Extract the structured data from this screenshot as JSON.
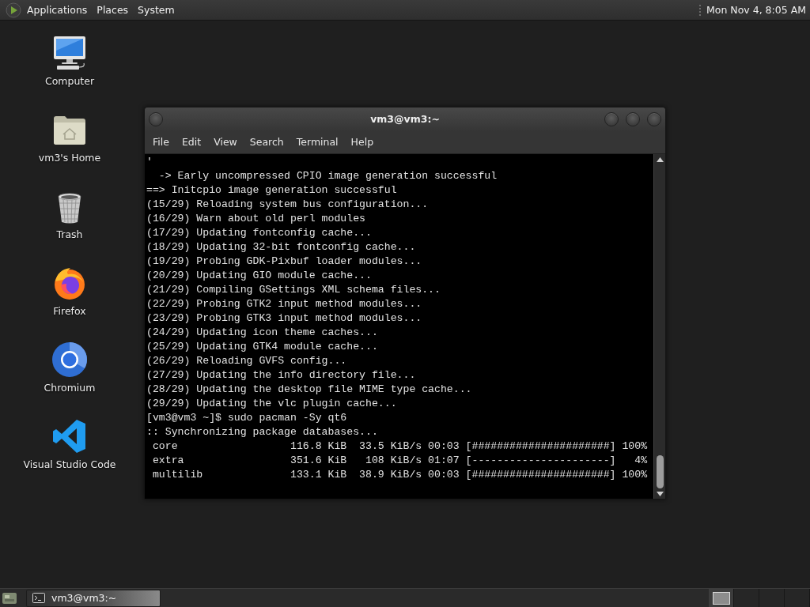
{
  "top_panel": {
    "menus": [
      "Applications",
      "Places",
      "System"
    ],
    "clock": "Mon Nov 4, 8:05 AM"
  },
  "desktop_icons": [
    {
      "label": "Computer",
      "kind": "computer"
    },
    {
      "label": "vm3's Home",
      "kind": "home"
    },
    {
      "label": "Trash",
      "kind": "trash"
    },
    {
      "label": "Firefox",
      "kind": "firefox"
    },
    {
      "label": "Chromium",
      "kind": "chromium"
    },
    {
      "label": "Visual Studio Code",
      "kind": "vscode"
    }
  ],
  "terminal_window": {
    "title": "vm3@vm3:~",
    "menu": [
      "File",
      "Edit",
      "View",
      "Search",
      "Terminal",
      "Help"
    ],
    "lines": [
      "'",
      "  -> Early uncompressed CPIO image generation successful",
      "==> Initcpio image generation successful",
      "(15/29) Reloading system bus configuration...",
      "(16/29) Warn about old perl modules",
      "(17/29) Updating fontconfig cache...",
      "(18/29) Updating 32-bit fontconfig cache...",
      "(19/29) Probing GDK-Pixbuf loader modules...",
      "(20/29) Updating GIO module cache...",
      "(21/29) Compiling GSettings XML schema files...",
      "(22/29) Probing GTK2 input method modules...",
      "(23/29) Probing GTK3 input method modules...",
      "(24/29) Updating icon theme caches...",
      "(25/29) Updating GTK4 module cache...",
      "(26/29) Reloading GVFS config...",
      "(27/29) Updating the info directory file...",
      "(28/29) Updating the desktop file MIME type cache...",
      "(29/29) Updating the vlc plugin cache...",
      "[vm3@vm3 ~]$ sudo pacman -Sy qt6",
      ":: Synchronizing package databases...",
      " core                  116.8 KiB  33.5 KiB/s 00:03 [######################] 100%",
      " extra                 351.6 KiB   108 KiB/s 01:07 [----------------------]   4%",
      " multilib              133.1 KiB  38.9 KiB/s 00:03 [######################] 100%"
    ]
  },
  "taskbar": {
    "tasks": [
      {
        "label": "vm3@vm3:~",
        "selected": true
      }
    ],
    "workspaces": [
      {
        "selected": true,
        "has_window": true
      },
      {
        "selected": false,
        "has_window": false
      },
      {
        "selected": false,
        "has_window": false
      },
      {
        "selected": false,
        "has_window": false
      }
    ]
  }
}
